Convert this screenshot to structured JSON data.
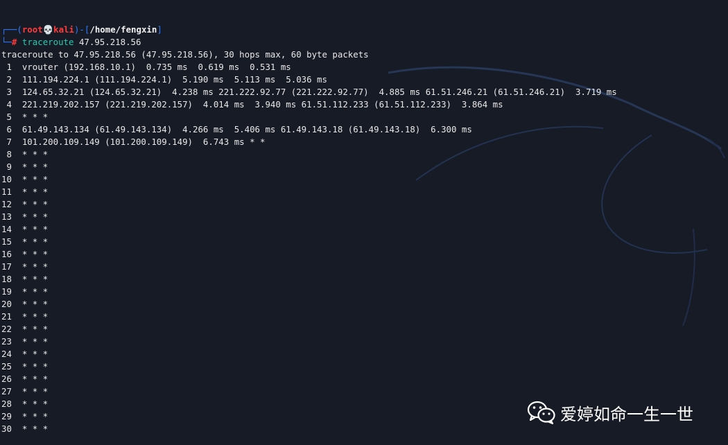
{
  "prompt": {
    "user": "root",
    "skull": "💀",
    "host": "kali",
    "path": "/home/fengxin",
    "hash": "#",
    "command": "traceroute",
    "argument": "47.95.218.56"
  },
  "output_header": "traceroute to 47.95.218.56 (47.95.218.56), 30 hops max, 60 byte packets",
  "hops": [
    " 1  vrouter (192.168.10.1)  0.735 ms  0.619 ms  0.531 ms",
    " 2  111.194.224.1 (111.194.224.1)  5.190 ms  5.113 ms  5.036 ms",
    " 3  124.65.32.21 (124.65.32.21)  4.238 ms 221.222.92.77 (221.222.92.77)  4.885 ms 61.51.246.21 (61.51.246.21)  3.719 ms",
    " 4  221.219.202.157 (221.219.202.157)  4.014 ms  3.940 ms 61.51.112.233 (61.51.112.233)  3.864 ms",
    " 5  * * *",
    " 6  61.49.143.134 (61.49.143.134)  4.266 ms  5.406 ms 61.49.143.18 (61.49.143.18)  6.300 ms",
    " 7  101.200.109.149 (101.200.109.149)  6.743 ms * *",
    " 8  * * *",
    " 9  * * *",
    "10  * * *",
    "11  * * *",
    "12  * * *",
    "13  * * *",
    "14  * * *",
    "15  * * *",
    "16  * * *",
    "17  * * *",
    "18  * * *",
    "19  * * *",
    "20  * * *",
    "21  * * *",
    "22  * * *",
    "23  * * *",
    "24  * * *",
    "25  * * *",
    "26  * * *",
    "27  * * *",
    "28  * * *",
    "29  * * *",
    "30  * * *"
  ],
  "watermark": {
    "icon": "wechat-icon",
    "text": "爱婷如命一生一世"
  },
  "colors": {
    "background": "#171b25",
    "frame": "#2f7bff",
    "user": "#ff3b3b",
    "command": "#29c9b0",
    "text": "#e8e8e8"
  }
}
